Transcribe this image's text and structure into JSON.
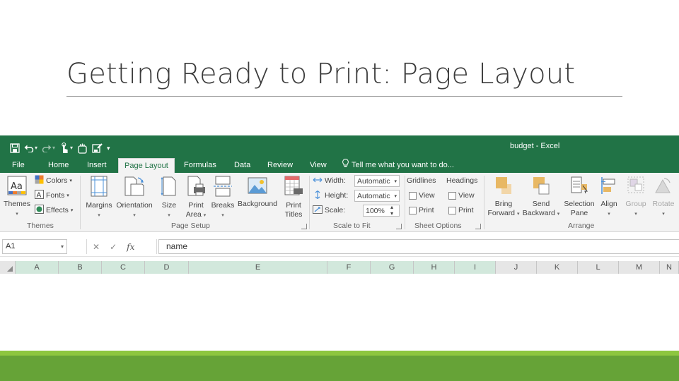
{
  "slide": {
    "title": "Getting Ready to Print:  Page Layout"
  },
  "window": {
    "title": "budget - Excel"
  },
  "tabs": [
    {
      "label": "File"
    },
    {
      "label": "Home"
    },
    {
      "label": "Insert"
    },
    {
      "label": "Page Layout",
      "active": true
    },
    {
      "label": "Formulas"
    },
    {
      "label": "Data"
    },
    {
      "label": "Review"
    },
    {
      "label": "View"
    }
  ],
  "tell_me": {
    "label": "Tell me what you want to do..."
  },
  "ribbon": {
    "themes": {
      "themes_label": "Themes",
      "colors_label": "Colors",
      "fonts_label": "Fonts",
      "effects_label": "Effects",
      "group_label": "Themes"
    },
    "page_setup": {
      "margins_label": "Margins",
      "orientation_label": "Orientation",
      "size_label": "Size",
      "print_area_label1": "Print",
      "print_area_label2": "Area",
      "breaks_label": "Breaks",
      "background_label": "Background",
      "print_titles_label1": "Print",
      "print_titles_label2": "Titles",
      "group_label": "Page Setup"
    },
    "scale_to_fit": {
      "width_label": "Width:",
      "width_value": "Automatic",
      "height_label": "Height:",
      "height_value": "Automatic",
      "scale_label": "Scale:",
      "scale_value": "100%",
      "group_label": "Scale to Fit"
    },
    "sheet_options": {
      "gridlines_label": "Gridlines",
      "headings_label": "Headings",
      "view_label": "View",
      "print_label": "Print",
      "group_label": "Sheet Options"
    },
    "arrange": {
      "bring_forward_label1": "Bring",
      "bring_forward_label2": "Forward",
      "send_backward_label1": "Send",
      "send_backward_label2": "Backward",
      "selection_pane_label1": "Selection",
      "selection_pane_label2": "Pane",
      "align_label": "Align",
      "group_btn_label": "Group",
      "rotate_label": "Rotate",
      "group_label": "Arrange"
    }
  },
  "formula_bar": {
    "name_box": "A1",
    "fx": "fx",
    "content": "name"
  },
  "columns": [
    "A",
    "B",
    "C",
    "D",
    "E",
    "F",
    "G",
    "H",
    "I",
    "J",
    "K",
    "L",
    "M",
    "N"
  ],
  "colors": {
    "excel_green": "#217346",
    "footer_light": "#8dc63f",
    "footer_dark": "#66a337",
    "selected_col_header": "#d2e8dc"
  }
}
